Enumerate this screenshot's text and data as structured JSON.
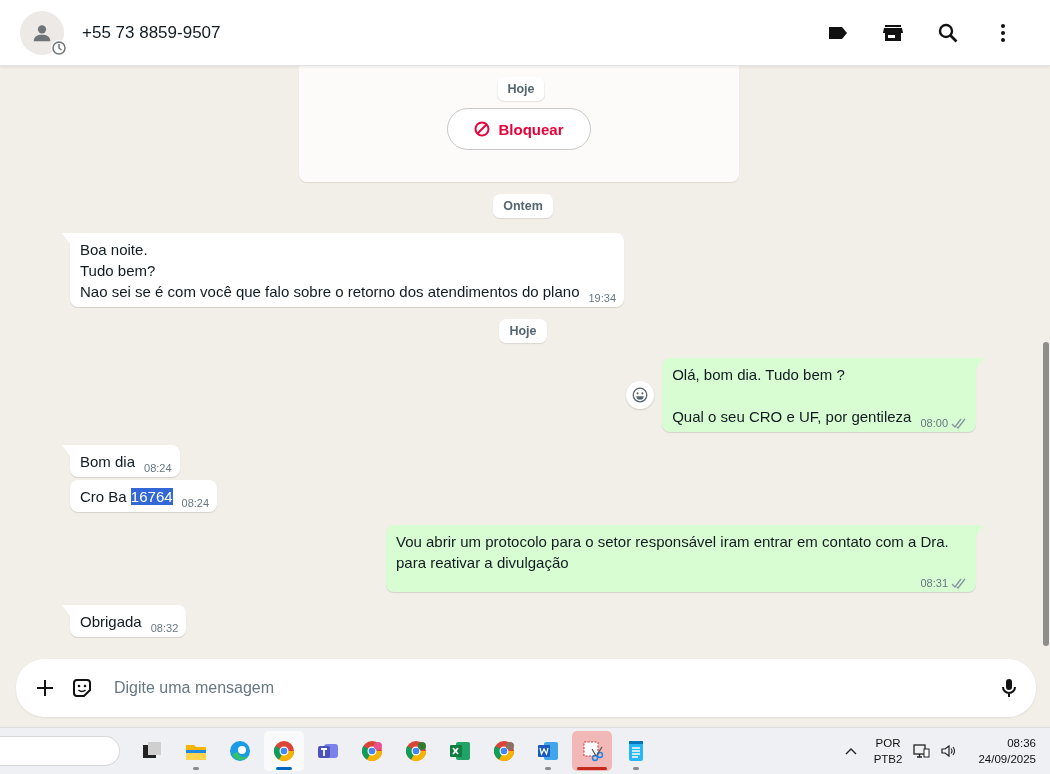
{
  "header": {
    "contact": "+55 73 8859-9507"
  },
  "chat": {
    "sticky_date": "Hoje",
    "block_button": "Bloquear",
    "items": [
      {
        "kind": "date",
        "text": "Ontem"
      },
      {
        "kind": "message",
        "outgoing": false,
        "tail": true,
        "text": "Boa noite.\nTudo bem?\nNao sei se é com você que falo sobre o retorno dos atendimentos do plano",
        "time": "19:34"
      },
      {
        "kind": "date",
        "text": "Hoje"
      },
      {
        "kind": "message",
        "outgoing": true,
        "tail": true,
        "react_button": true,
        "text": "Olá, bom dia. Tudo bem ?\n\nQual o seu CRO e UF, por gentileza",
        "time": "08:00"
      },
      {
        "kind": "message",
        "outgoing": false,
        "tail": true,
        "text": "Bom dia",
        "time": "08:24"
      },
      {
        "kind": "message",
        "outgoing": false,
        "tail": false,
        "segments": [
          {
            "text": "Cro Ba ",
            "selected": false
          },
          {
            "text": "16764",
            "selected": true
          }
        ],
        "time": "08:24"
      },
      {
        "kind": "message",
        "outgoing": true,
        "tail": true,
        "text": "Vou abrir um protocolo para o setor responsável iram entrar em contato com a Dra. para reativar a divulgação",
        "time": "08:31"
      },
      {
        "kind": "message",
        "outgoing": false,
        "tail": true,
        "text": "Obrigada",
        "time": "08:32"
      }
    ]
  },
  "composer": {
    "placeholder": "Digite uma mensagem"
  },
  "taskbar": {
    "apps": [
      {
        "kind": "task-view",
        "running": false,
        "active": false,
        "flashing": false
      },
      {
        "kind": "explorer",
        "running": true,
        "active": false,
        "flashing": false
      },
      {
        "kind": "edge",
        "running": false,
        "active": false,
        "flashing": false
      },
      {
        "kind": "chrome",
        "running": true,
        "active": true,
        "flashing": false
      },
      {
        "kind": "teams",
        "running": false,
        "active": false,
        "flashing": false
      },
      {
        "kind": "chrome",
        "running": false,
        "active": false,
        "flashing": false,
        "color": "#e8508f"
      },
      {
        "kind": "chrome",
        "running": false,
        "active": false,
        "flashing": false,
        "color": "#2e7d32"
      },
      {
        "kind": "excel",
        "running": false,
        "active": false,
        "flashing": false
      },
      {
        "kind": "chrome",
        "running": false,
        "active": false,
        "flashing": false,
        "color": "#8d6e63"
      },
      {
        "kind": "word",
        "running": true,
        "active": false,
        "flashing": false
      },
      {
        "kind": "snipping",
        "running": true,
        "active": false,
        "flashing": true
      },
      {
        "kind": "notepad",
        "running": true,
        "active": false,
        "flashing": false
      }
    ],
    "language": "POR",
    "layout": "PTB2",
    "time": "08:36",
    "date": "24/09/2025"
  }
}
